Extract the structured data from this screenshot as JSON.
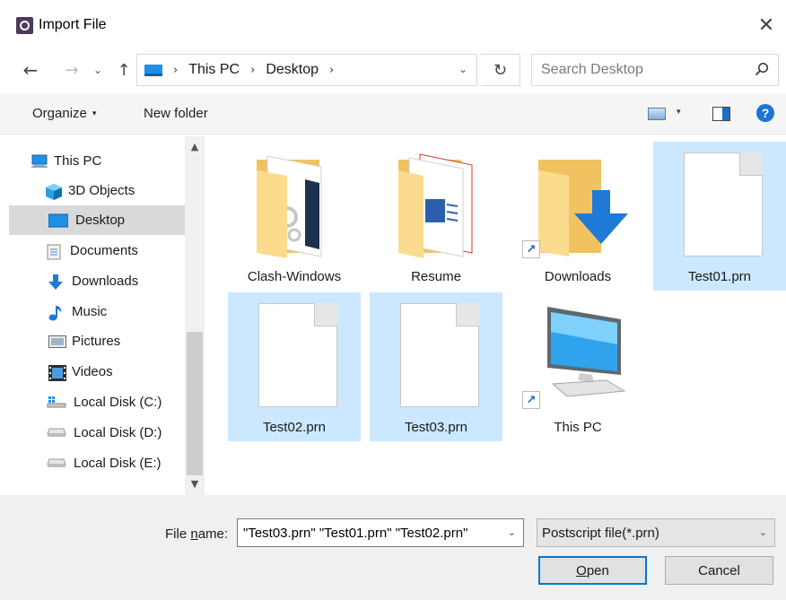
{
  "window": {
    "title": "Import File",
    "close_glyph": "✕"
  },
  "nav": {
    "back_glyph": "←",
    "forward_glyph": "→",
    "history_glyph": "⌄",
    "up_glyph": "↑",
    "breadcrumbs": [
      "This PC",
      "Desktop"
    ],
    "separator": "›",
    "dropdown_glyph": "⌄",
    "refresh_glyph": "↻"
  },
  "search": {
    "placeholder": "Search Desktop"
  },
  "toolbar": {
    "organize_label": "Organize",
    "organize_caret": "▾",
    "new_folder_label": "New folder",
    "view_caret": "▾",
    "help_glyph": "?"
  },
  "sidebar": {
    "items": [
      {
        "label": "This PC",
        "icon": "computer-icon"
      },
      {
        "label": "3D Objects",
        "icon": "cube-icon"
      },
      {
        "label": "Desktop",
        "icon": "desktop-icon",
        "selected": true
      },
      {
        "label": "Documents",
        "icon": "documents-icon"
      },
      {
        "label": "Downloads",
        "icon": "download-arrow-icon"
      },
      {
        "label": "Music",
        "icon": "music-note-icon"
      },
      {
        "label": "Pictures",
        "icon": "pictures-icon"
      },
      {
        "label": "Videos",
        "icon": "film-icon"
      },
      {
        "label": "Local Disk (C:)",
        "icon": "windows-drive-icon"
      },
      {
        "label": "Local Disk (D:)",
        "icon": "drive-icon"
      },
      {
        "label": "Local Disk (E:)",
        "icon": "drive-icon"
      }
    ],
    "scroll_up_glyph": "▲",
    "scroll_down_glyph": "▼"
  },
  "files": [
    {
      "name": "Clash-Windows",
      "type": "folder"
    },
    {
      "name": "Resume",
      "type": "folder"
    },
    {
      "name": "Downloads",
      "type": "folder-shortcut"
    },
    {
      "name": "Test01.prn",
      "type": "file",
      "selected": true
    },
    {
      "name": "Test02.prn",
      "type": "file",
      "selected": true
    },
    {
      "name": "Test03.prn",
      "type": "file",
      "selected": true
    },
    {
      "name": "This PC",
      "type": "computer-shortcut"
    }
  ],
  "shortcut_glyph": "↗",
  "footer": {
    "file_name_label_pre": "File ",
    "file_name_label_u": "n",
    "file_name_label_post": "ame:",
    "file_name_value": "\"Test03.prn\" \"Test01.prn\" \"Test02.prn\"",
    "file_type_value": "Postscript file(*.prn)",
    "dropdown_glyph": "⌄",
    "open_label_u": "O",
    "open_label_post": "pen",
    "cancel_label": "Cancel"
  },
  "colors": {
    "selection": "#cce8ff",
    "accent": "#0078d7",
    "folder": "#f3c969"
  }
}
